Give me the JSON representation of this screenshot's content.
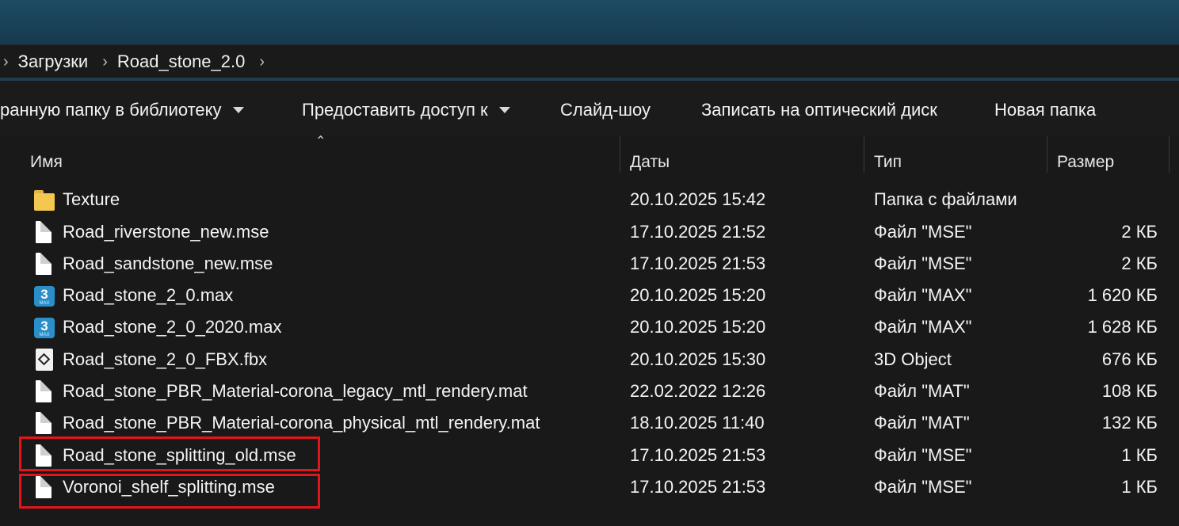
{
  "breadcrumb": {
    "items": [
      "Загрузки",
      "Road_stone_2.0"
    ]
  },
  "toolbar": {
    "items": [
      {
        "label": "ранную папку в библиотеку",
        "dropdown": true
      },
      {
        "label": "Предоставить доступ к",
        "dropdown": true
      },
      {
        "label": "Слайд-шоу",
        "dropdown": false
      },
      {
        "label": "Записать на оптический диск",
        "dropdown": false
      },
      {
        "label": "Новая папка",
        "dropdown": false
      }
    ]
  },
  "columns": {
    "name": "Имя",
    "date": "Даты",
    "type": "Тип",
    "size": "Размер"
  },
  "files": [
    {
      "name": "Texture",
      "date": "20.10.2025 15:42",
      "type": "Папка с файлами",
      "size": "",
      "icon": "folder-icon"
    },
    {
      "name": "Road_riverstone_new.mse",
      "date": "17.10.2025 21:52",
      "type": "Файл \"MSE\"",
      "size": "2 КБ",
      "icon": "file-icon"
    },
    {
      "name": "Road_sandstone_new.mse",
      "date": "17.10.2025 21:53",
      "type": "Файл \"MSE\"",
      "size": "2 КБ",
      "icon": "file-icon"
    },
    {
      "name": "Road_stone_2_0.max",
      "date": "20.10.2025 15:20",
      "type": "Файл \"MAX\"",
      "size": "1 620 КБ",
      "icon": "3dsmax-icon"
    },
    {
      "name": "Road_stone_2_0_2020.max",
      "date": "20.10.2025 15:20",
      "type": "Файл \"MAX\"",
      "size": "1 628 КБ",
      "icon": "3dsmax-icon"
    },
    {
      "name": "Road_stone_2_0_FBX.fbx",
      "date": "20.10.2025 15:30",
      "type": "3D Object",
      "size": "676 КБ",
      "icon": "3d-object-icon"
    },
    {
      "name": "Road_stone_PBR_Material-corona_legacy_mtl_rendery.mat",
      "date": "22.02.2022 12:26",
      "type": "Файл \"MAT\"",
      "size": "108 КБ",
      "icon": "file-icon"
    },
    {
      "name": "Road_stone_PBR_Material-corona_physical_mtl_rendery.mat",
      "date": "18.10.2025 11:40",
      "type": "Файл \"MAT\"",
      "size": "132 КБ",
      "icon": "file-icon"
    },
    {
      "name": "Road_stone_splitting_old.mse",
      "date": "17.10.2025 21:53",
      "type": "Файл \"MSE\"",
      "size": "1 КБ",
      "icon": "file-icon",
      "highlighted": true
    },
    {
      "name": "Voronoi_shelf_splitting.mse",
      "date": "17.10.2025 21:53",
      "type": "Файл \"MSE\"",
      "size": "1 КБ",
      "icon": "file-icon",
      "highlighted": true
    }
  ],
  "colors": {
    "background": "#191919",
    "titlebar": "#1e4a63",
    "highlight_box": "#e1151c",
    "folder": "#f4c84e",
    "max_icon": "#2a8fc8"
  }
}
